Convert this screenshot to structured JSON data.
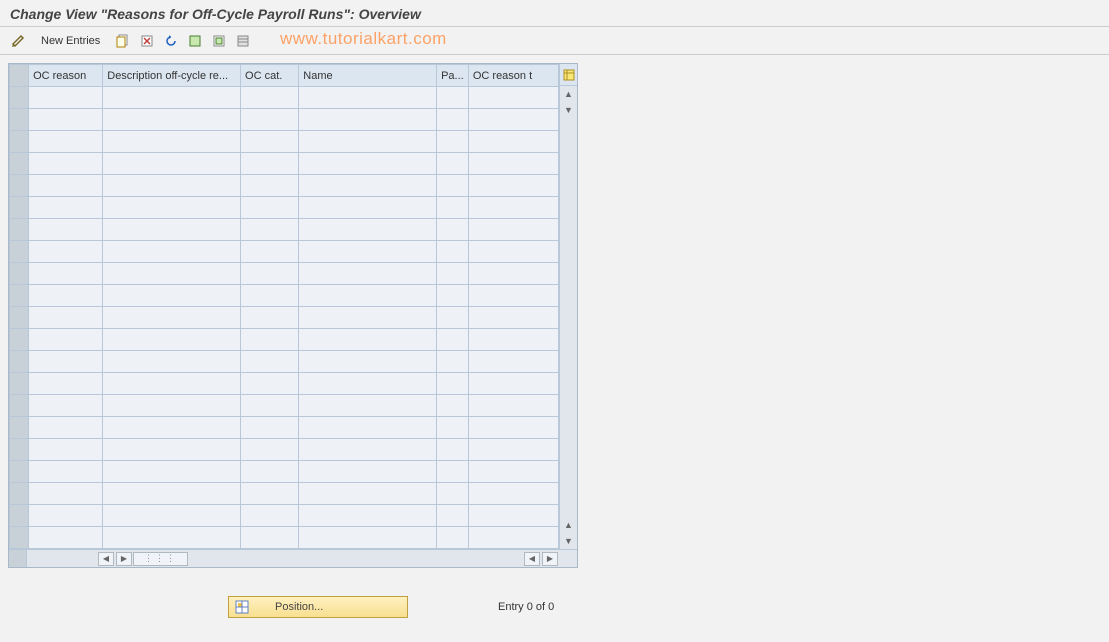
{
  "title": "Change View \"Reasons for Off-Cycle Payroll Runs\": Overview",
  "toolbar": {
    "new_entries": "New Entries"
  },
  "watermark": "www.tutorialkart.com",
  "table": {
    "columns": [
      "OC reason",
      "Description off-cycle re...",
      "OC cat.",
      "Name",
      "Pa...",
      "OC reason t"
    ],
    "row_count": 21
  },
  "footer": {
    "position_label": "Position...",
    "entry_text": "Entry 0 of 0"
  }
}
